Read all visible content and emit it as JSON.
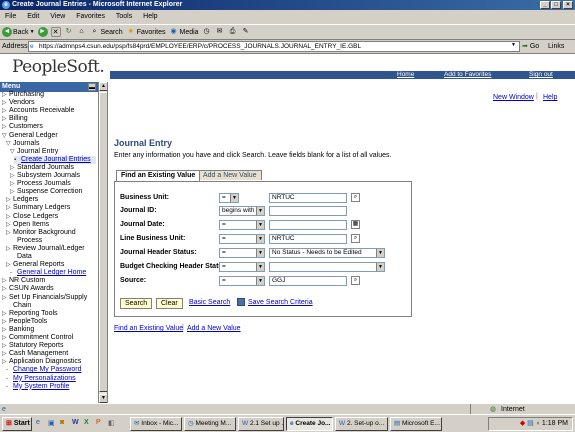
{
  "window": {
    "title": "Create Journal Entries - Microsoft Internet Explorer"
  },
  "menubar": [
    "File",
    "Edit",
    "View",
    "Favorites",
    "Tools",
    "Help"
  ],
  "toolbar": {
    "back": "Back",
    "search": "Search",
    "favorites": "Favorites",
    "media": "Media"
  },
  "addressbar": {
    "label": "Address",
    "url": "https://admnps4.csun.edu/psp/fs84prd/EMPLOYEE/ERP/c/PROCESS_JOURNALS.JOURNAL_ENTRY_IE.GBL",
    "go": "Go",
    "links": "Links"
  },
  "header": {
    "logo": "PeopleSoft.",
    "home": "Home",
    "add_favorites": "Add to Favorites",
    "signout": "Sign out"
  },
  "menu": {
    "title": "Menu",
    "items": [
      {
        "label": "Purchasing",
        "arrow": "▷"
      },
      {
        "label": "Vendors",
        "arrow": "▷"
      },
      {
        "label": "Accounts Receivable",
        "arrow": "▷"
      },
      {
        "label": "Billing",
        "arrow": "▷"
      },
      {
        "label": "Customers",
        "arrow": "▷"
      },
      {
        "label": "General Ledger",
        "arrow": "▽"
      },
      {
        "label": "Journals",
        "arrow": "▽"
      },
      {
        "label": "Journal Entry",
        "arrow": "▽"
      },
      {
        "label": "Create Journal Entries",
        "arrow": "▪"
      },
      {
        "label": "Standard Journals",
        "arrow": "▷"
      },
      {
        "label": "Subsystem Journals",
        "arrow": "▷"
      },
      {
        "label": "Process Journals",
        "arrow": "▷"
      },
      {
        "label": "Suspense Correction",
        "arrow": "▷"
      },
      {
        "label": "Ledgers",
        "arrow": "▷"
      },
      {
        "label": "Summary Ledgers",
        "arrow": "▷"
      },
      {
        "label": "Close Ledgers",
        "arrow": "▷"
      },
      {
        "label": "Open Items",
        "arrow": "▷"
      },
      {
        "label": "Monitor Background",
        "arrow": "▷"
      },
      {
        "label": "Process",
        "arrow": ""
      },
      {
        "label": "Review Journal/Ledger",
        "arrow": "▷"
      },
      {
        "label": "Data",
        "arrow": ""
      },
      {
        "label": "General Reports",
        "arrow": "▷"
      },
      {
        "label": "General Ledger Home",
        "arrow": "-"
      },
      {
        "label": "NR Custom",
        "arrow": "▷"
      },
      {
        "label": "CSUN Awards",
        "arrow": "▷"
      },
      {
        "label": "Set Up Financials/Supply",
        "arrow": "▷"
      },
      {
        "label": "Chain",
        "arrow": ""
      },
      {
        "label": "Reporting Tools",
        "arrow": "▷"
      },
      {
        "label": "PeopleTools",
        "arrow": "▷"
      },
      {
        "label": "Banking",
        "arrow": "▷"
      },
      {
        "label": "Commitment Control",
        "arrow": "▷"
      },
      {
        "label": "Statutory Reports",
        "arrow": "▷"
      },
      {
        "label": "Cash Management",
        "arrow": "▷"
      },
      {
        "label": "Application Diagnostics",
        "arrow": "▷"
      },
      {
        "label": "Change My Password",
        "arrow": "-"
      },
      {
        "label": "My Personalizations",
        "arrow": "-"
      },
      {
        "label": "My System Profile",
        "arrow": "-"
      }
    ]
  },
  "content": {
    "new_window": "New Window",
    "help": "Help",
    "title": "Journal Entry",
    "instructions": "Enter any information you have and click Search. Leave fields blank for a list of all values.",
    "tab_find": "Find an Existing Value",
    "tab_add": "Add a New Value",
    "fields": [
      {
        "label": "Business Unit:",
        "operator": "=",
        "value": "NRTUC"
      },
      {
        "label": "Journal ID:",
        "operator": "begins with",
        "value": ""
      },
      {
        "label": "Journal Date:",
        "operator": "=",
        "value": ""
      },
      {
        "label": "Line Business Unit:",
        "operator": "=",
        "value": "NRTUC"
      },
      {
        "label": "Journal Header Status:",
        "operator": "=",
        "value": "No Status - Needs to be Edited"
      },
      {
        "label": "Budget Checking Header Status:",
        "operator": "=",
        "value": ""
      },
      {
        "label": "Source:",
        "operator": "=",
        "value": "GGJ"
      }
    ],
    "search_btn": "Search",
    "clear_btn": "Clear",
    "basic_search": "Basic Search",
    "save_criteria": "Save Search Criteria",
    "bottom_find": "Find an Existing Value",
    "bottom_add": "Add a New Value"
  },
  "statusbar": {
    "zone": "Internet"
  },
  "taskbar": {
    "start": "Start",
    "tasks": [
      "Inbox - Mic...",
      "Meeting M...",
      "2.1 Set up ...",
      "Create Jo...",
      "2. Set-up o...",
      "Microsoft E..."
    ],
    "active_task": "Create Jo...",
    "clock": "1:18 PM"
  }
}
